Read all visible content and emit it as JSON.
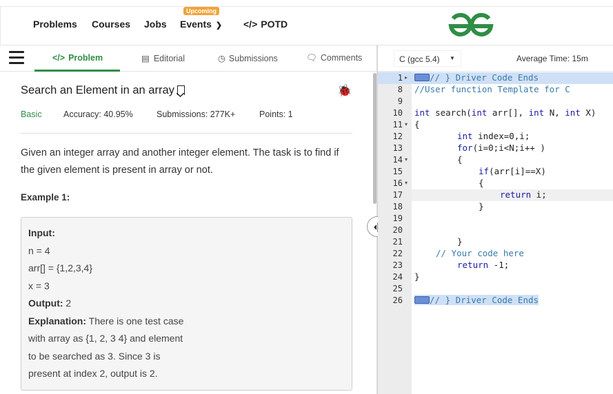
{
  "topnav": {
    "items": [
      "Problems",
      "Courses",
      "Jobs",
      "Events",
      "POTD"
    ],
    "badge": "Upcoming",
    "potd_prefix": "</>"
  },
  "logo": {
    "name": "gfg-logo",
    "color": "#2f8d46"
  },
  "tabs": [
    {
      "label": "Problem",
      "icon": "code-icon",
      "active": true
    },
    {
      "label": "Editorial",
      "icon": "document-icon",
      "active": false
    },
    {
      "label": "Submissions",
      "icon": "clock-icon",
      "active": false
    },
    {
      "label": "Comments",
      "icon": "comment-icon",
      "active": false
    }
  ],
  "problem": {
    "title": "Search an Element in an array",
    "difficulty": "Basic",
    "accuracy": "Accuracy: 40.95%",
    "submissions": "Submissions: 277K+",
    "points": "Points: 1",
    "description": "Given an integer array and another integer element. The task is to find if the given element is present in array or not.",
    "example_heading": "Example 1:",
    "example": {
      "input_label": "Input:",
      "n": "n = 4",
      "arr": "arr[] = {1,2,3,4}",
      "x": "x = 3",
      "output_label": "Output:",
      "output_value": "2",
      "explanation_label": "Explanation:",
      "explanation_lines": [
        "There is one test case",
        "with array as {1, 2, 3 4} and element",
        "to be searched as 3.  Since 3 is",
        "present at index 2, output is 2."
      ]
    }
  },
  "editor": {
    "language": "C (gcc 5.4)",
    "average_time": "Average Time: 15m",
    "lines": [
      {
        "n": "1",
        "text": "// } Driver Code Ends"
      },
      {
        "n": "8",
        "text": "//User function Template for C"
      },
      {
        "n": "9",
        "text": ""
      },
      {
        "n": "10",
        "text": "int search(int arr[], int N, int X)"
      },
      {
        "n": "11",
        "text": "{"
      },
      {
        "n": "12",
        "text": "int index=0,i;"
      },
      {
        "n": "13",
        "text": "for(i=0;i<N;i++ )"
      },
      {
        "n": "14",
        "text": "{"
      },
      {
        "n": "15",
        "text": "if(arr[i]==X)"
      },
      {
        "n": "16",
        "text": "{"
      },
      {
        "n": "17",
        "text": "return i;"
      },
      {
        "n": "18",
        "text": "}"
      },
      {
        "n": "19",
        "text": ""
      },
      {
        "n": "20",
        "text": ""
      },
      {
        "n": "21",
        "text": "}"
      },
      {
        "n": "22",
        "text": "// Your code here"
      },
      {
        "n": "23",
        "text": "return -1;"
      },
      {
        "n": "24",
        "text": "}"
      },
      {
        "n": "25",
        "text": ""
      },
      {
        "n": "26",
        "text": "// } Driver Code Ends"
      }
    ]
  }
}
